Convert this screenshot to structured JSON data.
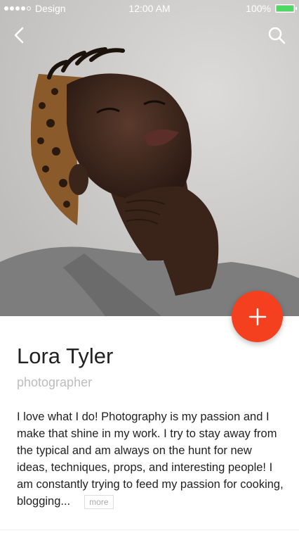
{
  "status_bar": {
    "carrier": "Design",
    "time": "12:00 AM",
    "battery_text": "100%",
    "battery_level": 1.0,
    "signal_bars_filled": 4,
    "signal_bars_total": 5
  },
  "nav": {
    "back_icon": "chevron-left-icon",
    "search_icon": "search-icon"
  },
  "hero": {
    "image_subject": "portrait-photo"
  },
  "fab": {
    "icon": "plus-icon",
    "color": "#f4401f"
  },
  "profile": {
    "name": "Lora Tyler",
    "role": "photographer",
    "bio": "I love what I do!  Photography is my passion and I make that shine in my work.  I try to stay away from the typical and am always on the hunt for new ideas, techniques, props, and interesting people!  I am constantly trying to feed my passion for cooking, blogging...",
    "more_label": "more"
  },
  "colors": {
    "accent": "#f4401f",
    "battery": "#4cd964",
    "muted_text": "#bdbdbd"
  }
}
